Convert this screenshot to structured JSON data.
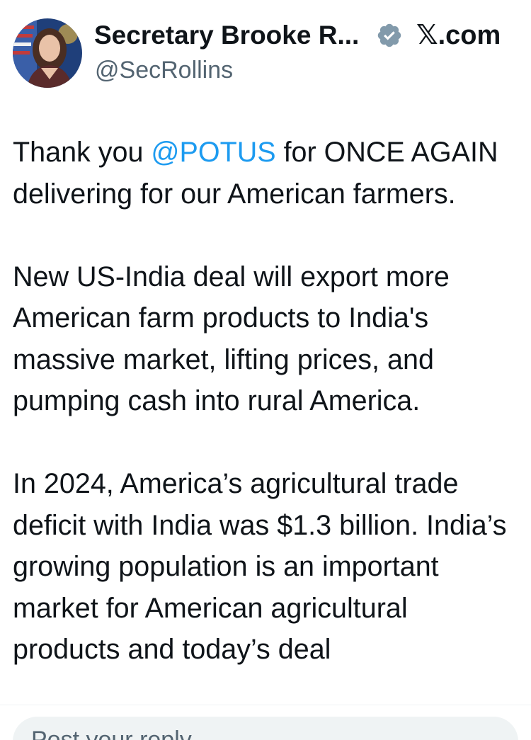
{
  "author": {
    "name": "Secretary Brooke R...",
    "handle": "@SecRollins",
    "verified": true,
    "verified_badge_color": "#829aab"
  },
  "site_label": "𝕏.com",
  "tweet": {
    "p1_mention": "@POTUS",
    "p1_rest_a": "Thank you ",
    "p1_rest_b": " for ONCE AGAIN delivering for our American farmers.",
    "p2": "New US-India deal will export more American farm products to India's massive market, lifting prices, and pumping cash into rural America.",
    "p3": "In 2024, America’s agricultural trade deficit with India was $1.3 billion. India’s growing population is an important market for American agricultural products and today’s deal"
  },
  "reply": {
    "placeholder": "Post your reply"
  },
  "colors": {
    "link": "#1d9bf0",
    "secondary_text": "#536471",
    "text": "#0f1419"
  }
}
